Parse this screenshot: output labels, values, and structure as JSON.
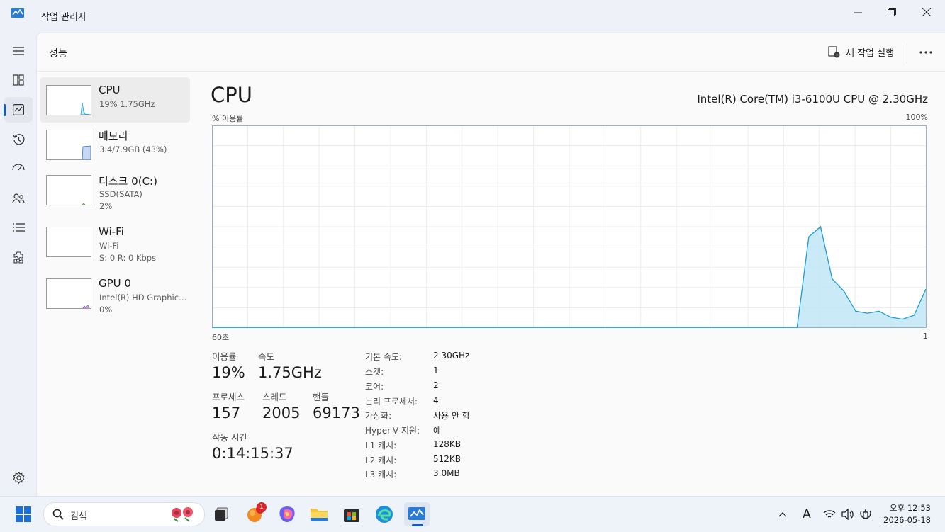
{
  "window": {
    "title": "작업 관리자"
  },
  "header": {
    "page_title": "성능",
    "run_new_task": "새 작업 실행"
  },
  "rail": {
    "icons": [
      "hamburger-icon",
      "processes-icon",
      "performance-icon",
      "app-history-icon",
      "startup-icon",
      "users-icon",
      "details-icon",
      "services-icon",
      "settings-icon"
    ]
  },
  "devices": [
    {
      "name": "CPU",
      "line1": "19%  1.75GHz",
      "line2": ""
    },
    {
      "name": "메모리",
      "line1": "3.4/7.9GB (43%)",
      "line2": ""
    },
    {
      "name": "디스크 0(C:)",
      "line1": "SSD(SATA)",
      "line2": "2%"
    },
    {
      "name": "Wi-Fi",
      "line1": "Wi-Fi",
      "line2": "S: 0  R: 0 Kbps"
    },
    {
      "name": "GPU 0",
      "line1": "Intel(R) HD Graphics ...",
      "line2": "0%"
    }
  ],
  "detail": {
    "title": "CPU",
    "model": "Intel(R) Core(TM) i3-6100U CPU @ 2.30GHz",
    "graph_label": "% 이용률",
    "graph_max": "100%",
    "graph_left": "60초",
    "graph_right": "1",
    "usage_series": [
      0,
      0,
      0,
      0,
      0,
      0,
      0,
      0,
      0,
      0,
      0,
      0,
      0,
      0,
      0,
      0,
      0,
      0,
      0,
      0,
      0,
      0,
      0,
      0,
      0,
      0,
      0,
      0,
      0,
      0,
      0,
      0,
      0,
      0,
      0,
      0,
      0,
      0,
      0,
      0,
      0,
      0,
      0,
      0,
      0,
      0,
      0,
      0,
      0,
      0,
      0,
      45,
      50,
      24,
      18,
      8,
      7,
      8,
      5,
      4,
      6,
      19
    ]
  },
  "stats": {
    "usage_label": "이용률",
    "usage": "19%",
    "speed_label": "속도",
    "speed": "1.75GHz",
    "proc_label": "프로세스",
    "proc": "157",
    "thread_label": "스레드",
    "thread": "2005",
    "handle_label": "핸들",
    "handle": "69173",
    "uptime_label": "작동 시간",
    "uptime": "0:14:15:37"
  },
  "info": [
    {
      "k": "기본 속도:",
      "v": "2.30GHz"
    },
    {
      "k": "소켓:",
      "v": "1"
    },
    {
      "k": "코어:",
      "v": "2"
    },
    {
      "k": "논리 프로세서:",
      "v": "4"
    },
    {
      "k": "가상화:",
      "v": "사용 안 함"
    },
    {
      "k": "Hyper-V 지원:",
      "v": "예"
    },
    {
      "k": "L1 캐시:",
      "v": "128KB"
    },
    {
      "k": "L2 캐시:",
      "v": "512KB"
    },
    {
      "k": "L3 캐시:",
      "v": "3.0MB"
    }
  ],
  "taskbar": {
    "search_placeholder": "검색",
    "badge": "1",
    "ime": "A",
    "time": "오후 12:53",
    "date": "2026-05-18"
  },
  "colors": {
    "accent": "#0f5cc0",
    "graph_line": "#1b9dd8",
    "graph_fill": "#bfe6f5",
    "grid": "#e9edf1"
  }
}
